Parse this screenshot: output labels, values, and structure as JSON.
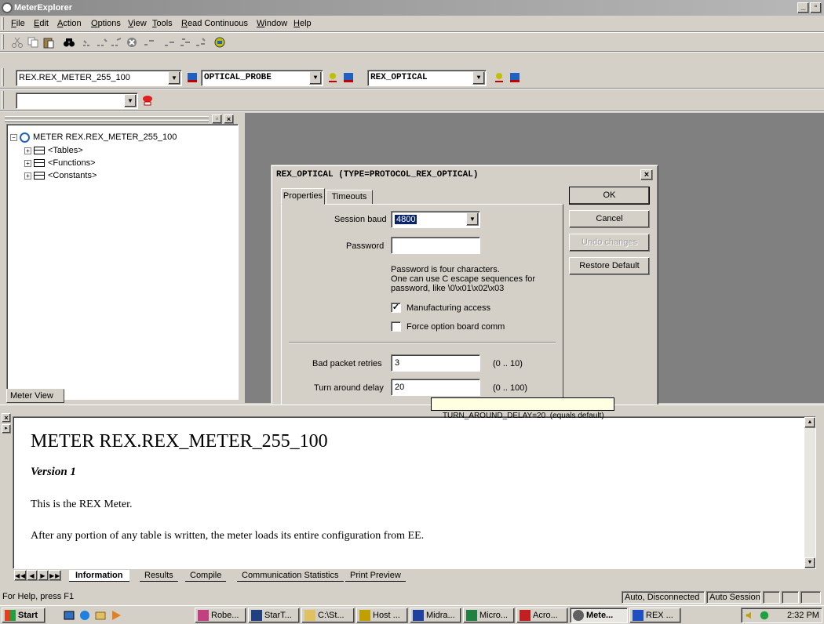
{
  "window": {
    "title": "MeterExplorer"
  },
  "menu": [
    "File",
    "Edit",
    "Action",
    "Options",
    "View",
    "Tools",
    "Read Continuous",
    "Window",
    "Help"
  ],
  "toolbar": {
    "meter_combo": "REX.REX_METER_255_100",
    "probe_combo": "OPTICAL_PROBE",
    "protocol_combo": "REX_OPTICAL",
    "empty_combo": ""
  },
  "tree": {
    "root": "METER REX.REX_METER_255_100",
    "children": [
      "<Tables>",
      "<Functions>",
      "<Constants>"
    ],
    "tab": "Meter View"
  },
  "dialog": {
    "title": "REX_OPTICAL (TYPE=PROTOCOL_REX_OPTICAL)",
    "tabs": [
      "Properties",
      "Timeouts"
    ],
    "session_baud_label": "Session baud",
    "session_baud_value": "4800",
    "password_label": "Password",
    "password_value": "",
    "password_help_1": "Password is four characters.",
    "password_help_2": "One can use C escape sequences for",
    "password_help_3": "password, like \\0\\x01\\x02\\x03",
    "manufacturing_access_label": "Manufacturing access",
    "manufacturing_access_checked": true,
    "force_option_label": "Force option board comm",
    "force_option_checked": false,
    "bad_packet_label": "Bad packet retries",
    "bad_packet_value": "3",
    "bad_packet_range": "(0 .. 10)",
    "turn_around_label": "Turn around delay",
    "turn_around_value": "20",
    "turn_around_range": "(0 .. 100)",
    "tooltip": "TURN_AROUND_DELAY=20  (equals default)",
    "buttons": {
      "ok": "OK",
      "cancel": "Cancel",
      "undo": "Undo changes",
      "restore": "Restore Default"
    }
  },
  "info": {
    "heading": "METER REX.REX_METER_255_100",
    "version": "Version 1",
    "line1": "This is the REX Meter.",
    "line2": "After any portion of any table is written, the meter loads its entire configuration from EE.",
    "tabs": [
      "Information",
      "Results",
      "Compile",
      "Communication Statistics",
      "Print Preview"
    ]
  },
  "status": {
    "help": "For Help, press F1",
    "connection": "Auto, Disconnected",
    "session": "Auto Session"
  },
  "taskbar": {
    "start": "Start",
    "tasks": [
      "Robe...",
      "StarT...",
      "C:\\St...",
      "Host ...",
      "Midra...",
      "Micro...",
      "Acro...",
      "Mete...",
      "REX ..."
    ],
    "clock": "2:32 PM"
  },
  "colors": {
    "title_gradient_start": "#8a8a8a",
    "mdi_background": "#808080",
    "face": "#d4d0c8"
  }
}
